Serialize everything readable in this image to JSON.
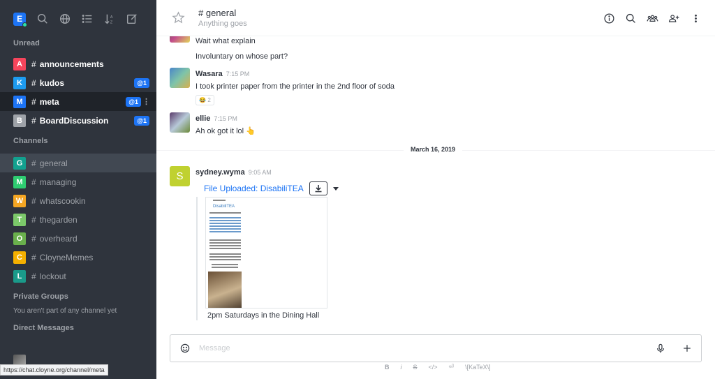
{
  "sidebar": {
    "logo_letter": "E",
    "toolbar_icons": [
      "search-icon",
      "globe-icon",
      "list-icon",
      "sort-icon",
      "edit-icon"
    ],
    "sections": {
      "unread": "Unread",
      "channels": "Channels",
      "private_groups": "Private Groups",
      "direct_messages": "Direct Messages"
    },
    "unread_rooms": [
      {
        "letter": "A",
        "name": "announcements",
        "color": "#f5455c",
        "mention": ""
      },
      {
        "letter": "K",
        "name": "kudos",
        "color": "#1d9bf0",
        "mention": "@1"
      },
      {
        "letter": "M",
        "name": "meta",
        "color": "#1d74f5",
        "mention": "@1"
      },
      {
        "letter": "B",
        "name": "BoardDiscussion",
        "color": "#9ea2a8",
        "mention": "@1"
      }
    ],
    "channels": [
      {
        "letter": "G",
        "name": "general",
        "color": "#12a18f"
      },
      {
        "letter": "M",
        "name": "managing",
        "color": "#2ecc71"
      },
      {
        "letter": "W",
        "name": "whatscookin",
        "color": "#f5a623"
      },
      {
        "letter": "T",
        "name": "thegarden",
        "color": "#7cc96a"
      },
      {
        "letter": "O",
        "name": "overheard",
        "color": "#6ab04c"
      },
      {
        "letter": "C",
        "name": "CloyneMemes",
        "color": "#f5b000"
      },
      {
        "letter": "L",
        "name": "lockout",
        "color": "#1a9a8a"
      }
    ],
    "private_empty": "You aren't part of any channel yet",
    "status_url": "https://chat.cloyne.org/channel/meta"
  },
  "header": {
    "title": "# general",
    "topic": "Anything goes",
    "actions": [
      "info-icon",
      "search-icon",
      "members-icon",
      "add-user-icon",
      "kebab-icon"
    ]
  },
  "messages": {
    "m1_line1": "Wait what explain",
    "m1_line2": "Involuntary on whose part?",
    "m2_user": "Wasara",
    "m2_time": "7:15 PM",
    "m2_text": "I took printer paper from the printer in the 2nd floor of soda",
    "m2_reaction": "😂 2",
    "m3_user": "ellie",
    "m3_time": "7:15 PM",
    "m3_text": "Ah ok got it lol 👆",
    "day_divider": "March 16, 2019",
    "m4_avatar_letter": "S",
    "m4_user": "sydney.wyma",
    "m4_time": "9:05 AM",
    "m4_file_title": "File Uploaded: DisabiliTEA",
    "m4_file_desc": "2pm Saturdays in the Dining Hall",
    "doc_title": "DisabiliTEA"
  },
  "composer": {
    "placeholder": "Message",
    "format_labels": [
      "B",
      "i",
      "S",
      "</>",
      "⏎",
      "\\[KaTeX\\]"
    ]
  },
  "colors": {
    "sidebar_bg": "#2f343d",
    "accent": "#1d74f5",
    "s_avatar": "#c0d130"
  }
}
